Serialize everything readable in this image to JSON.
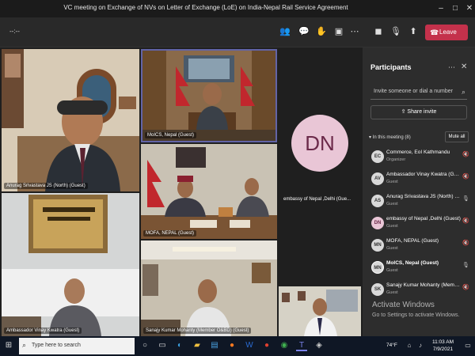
{
  "window": {
    "title": "VC meeting on Exchange of NVs on Letter of Exchange (LoE) on India-Nepal Rail Service Agreement"
  },
  "toolbar": {
    "timer": "--:--",
    "leave_label": "Leave"
  },
  "video_tiles": [
    {
      "caption": "Anurag Srivastava JS (North) (Guest)"
    },
    {
      "caption": "MoICS, Nepal (Guest)"
    },
    {
      "caption": "MOFA, NEPAL (Guest)"
    },
    {
      "caption": "Ambassador Vinay Kwatra (Guest)"
    },
    {
      "caption": "Sanajy Kumar Mohanty (Member O&BD) (Guest)"
    },
    {
      "caption": "embassy of Nepal ,Delhi (Gue..."
    }
  ],
  "avatar_tile": {
    "initials": "DN"
  },
  "participants": {
    "title": "Participants",
    "invite_placeholder": "Invite someone or dial a number",
    "share_invite": "Share invite",
    "section_label": "In this meeting (8)",
    "mute_all": "Mute all",
    "list": [
      {
        "initials": "EC",
        "name": "Commerce, EoI Kathmandu",
        "role": "Organizer"
      },
      {
        "initials": "AV",
        "name": "Ambassador Vinay Kwatra (Guest)",
        "role": "Guest"
      },
      {
        "initials": "AS",
        "name": "Anurag Srivastava JS (North) (Gu...",
        "role": "Guest"
      },
      {
        "initials": "DN",
        "name": "embassy of Nepal ,Delhi (Guest)",
        "role": "Guest"
      },
      {
        "initials": "MN",
        "name": "MOFA, NEPAL (Guest)",
        "role": "Guest"
      },
      {
        "initials": "MN",
        "name": "MoICS, Nepal (Guest)",
        "role": "Guest"
      },
      {
        "initials": "SK",
        "name": "Sanajy Kumar Mohanty (Membe...",
        "role": "Guest"
      }
    ]
  },
  "watermark": {
    "line1": "Activate Windows",
    "line2": "Go to Settings to activate Windows."
  },
  "taskbar": {
    "search_placeholder": "Type here to search",
    "weather": "74°F",
    "time": "11:03 AM",
    "date": "7/9/2021"
  },
  "colors": {
    "leave": "#c4314b",
    "avatar_bg": "#e9c6d6",
    "avatar_text": "#6b2a4a",
    "active_border": "#6264a7"
  }
}
